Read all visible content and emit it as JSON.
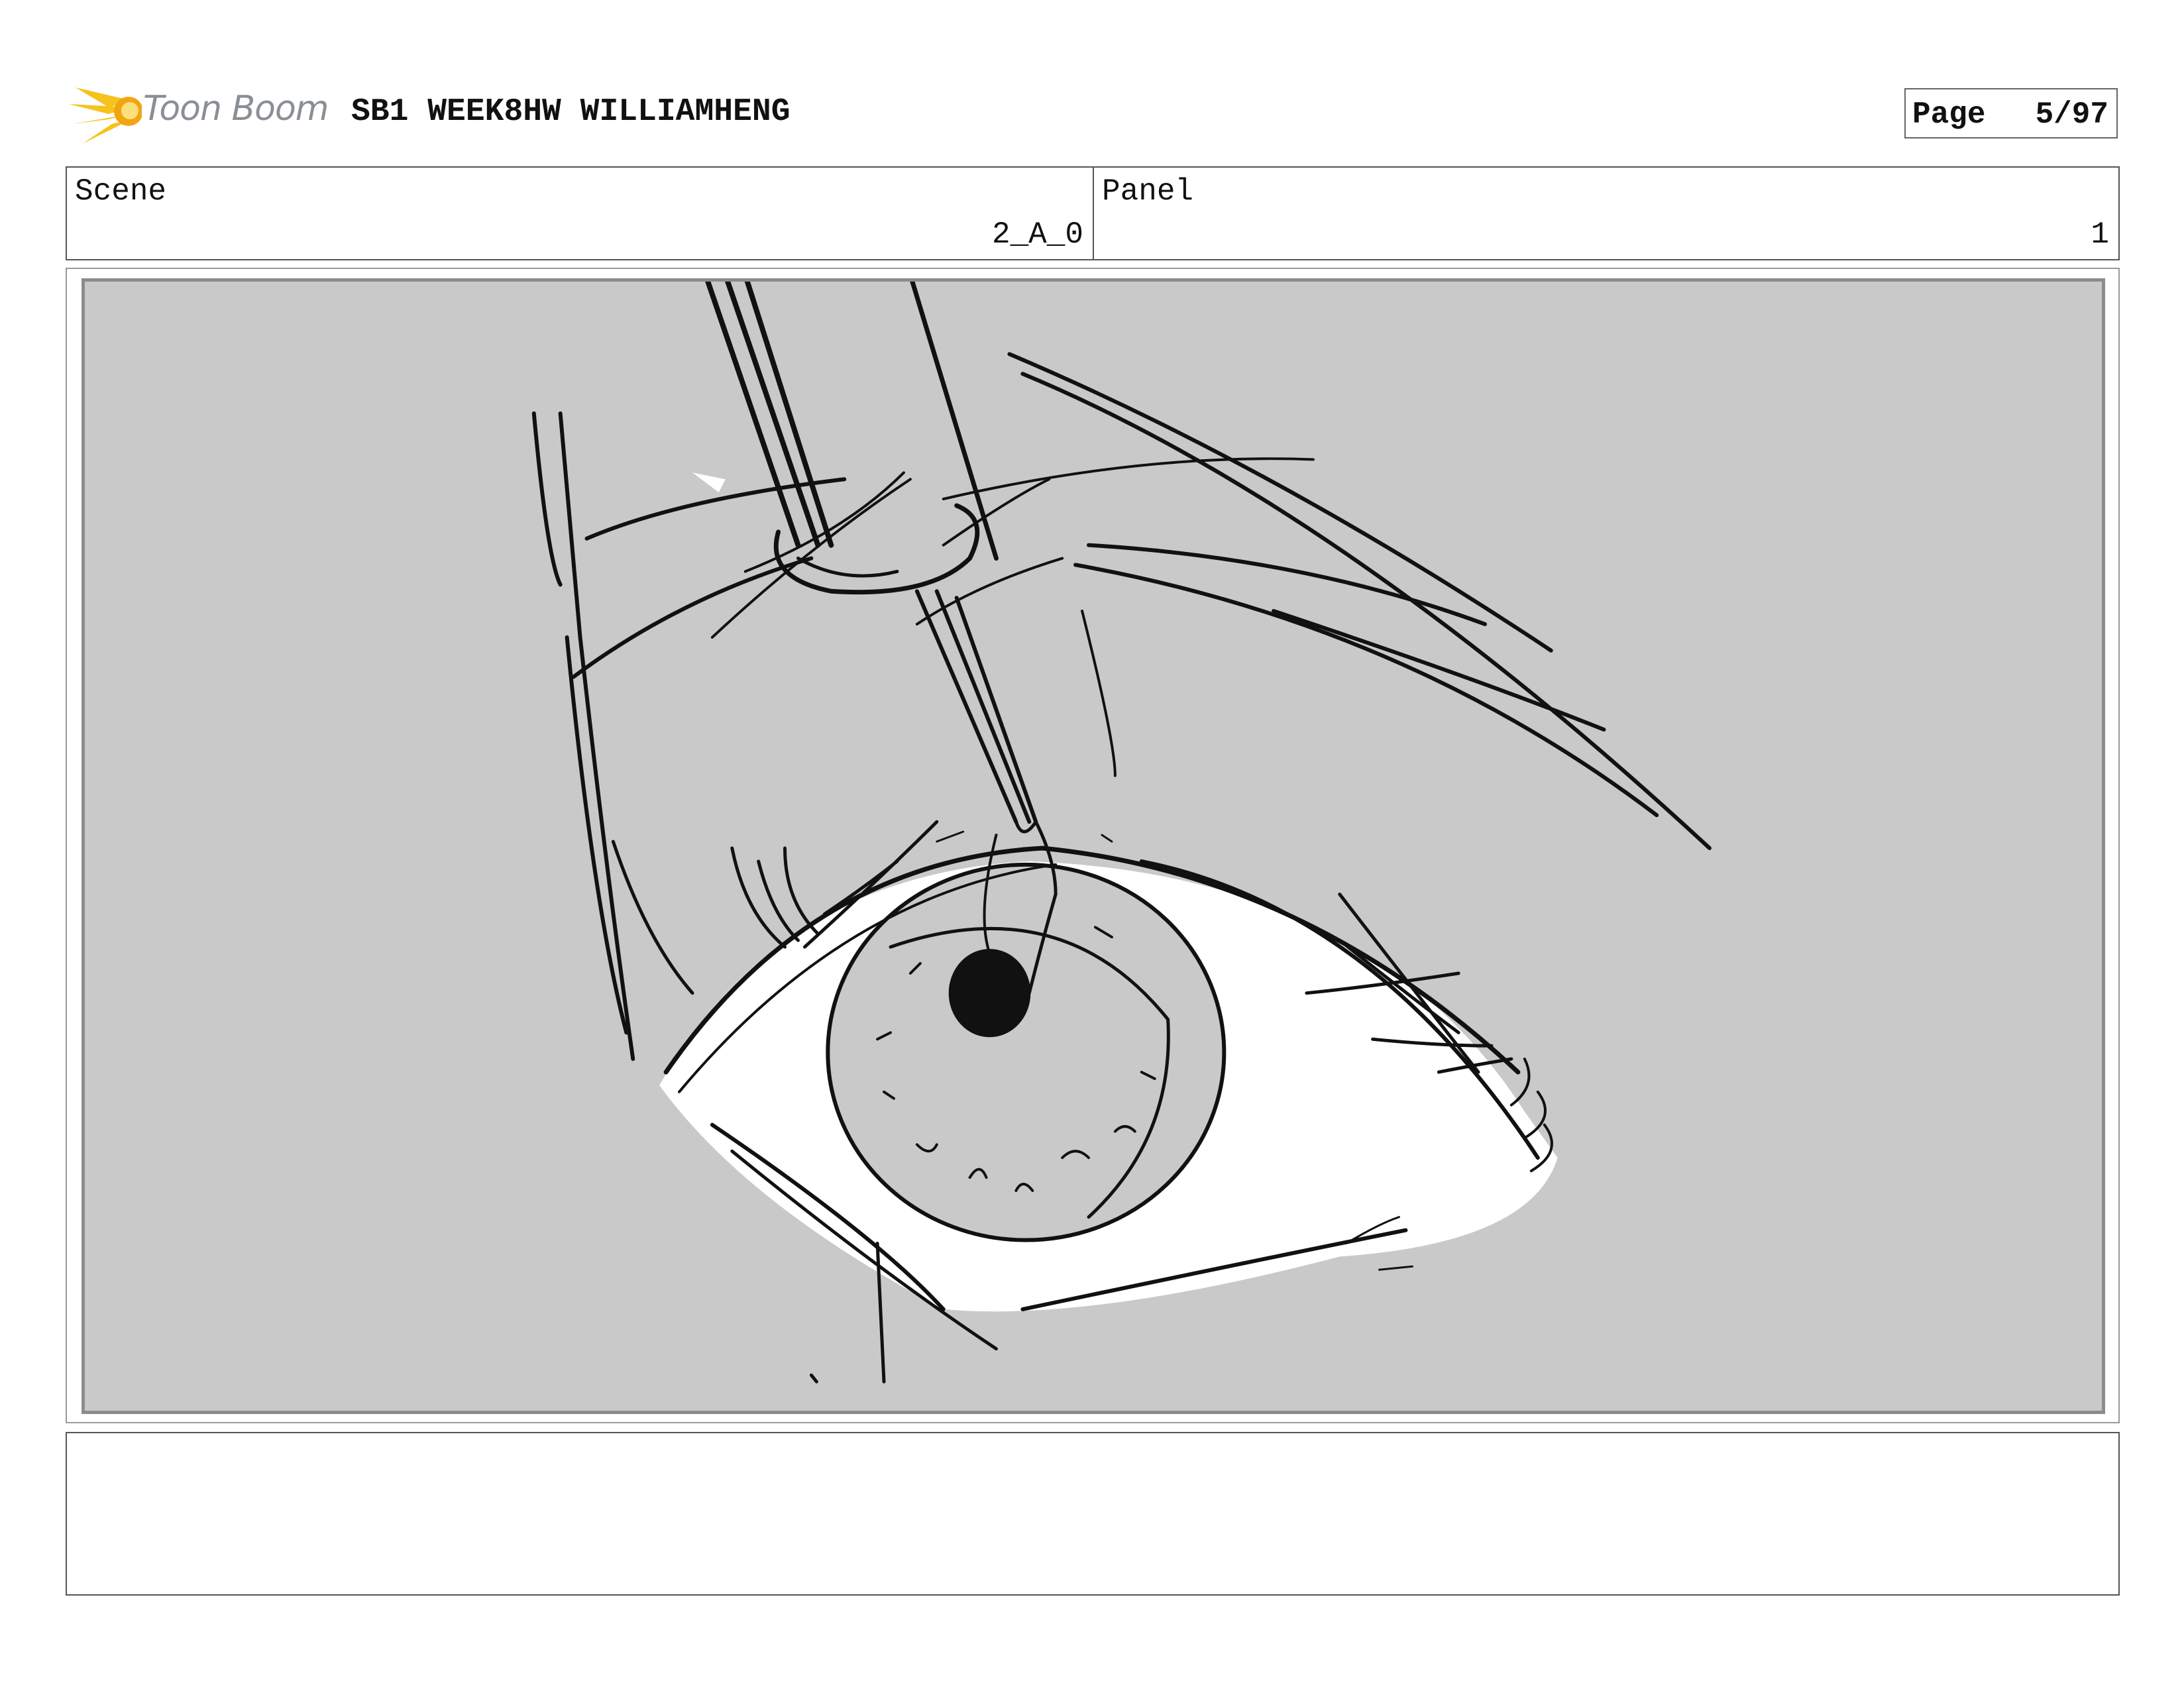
{
  "header": {
    "logo_text": "Toon Boom",
    "document_title": "SB1 WEEK8HW WILLIAMHENG",
    "page_label": "Page",
    "page_value": "5/97"
  },
  "info": {
    "scene_label": "Scene",
    "scene_value": "2_A_0",
    "panel_label": "Panel",
    "panel_value": "1"
  },
  "panel_image": {
    "subject": "rough storyboard sketch of an eye with an eye dropper above it",
    "background_color": "#c9c9c9"
  },
  "notes": {
    "text": ""
  }
}
